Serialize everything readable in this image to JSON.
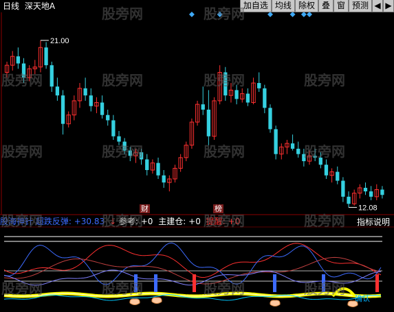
{
  "toolbar": {
    "period": "日线",
    "stock_name": "深天地A",
    "buttons": [
      "加自选",
      "均线",
      "除权",
      "叠",
      "窗",
      "预测"
    ],
    "nav_left": "◀",
    "nav_right": "▶"
  },
  "price_chart": {
    "high_label": "21.00",
    "low_label": "12.08",
    "ylim": [
      11.5,
      22.5
    ],
    "colors": {
      "up": "#ff3030",
      "down": "#35d0e0",
      "diamond": "#3fa9f5",
      "background": "#000000",
      "grid": "#8b0000"
    }
  },
  "markers": {
    "cai": "财",
    "bang": "榜"
  },
  "indicator_bar": {
    "name": "股海神针",
    "rebound_label": "超跌反弹:",
    "rebound_value": "+30.83",
    "reference_label": "参考:",
    "reference_value": "+0",
    "build_label": "主建仓:",
    "build_value": "+0",
    "alert_label": "提醒:",
    "alert_value": "+0",
    "explain_button": "指标说明",
    "buy_tag": "确认"
  },
  "watermark": "股旁网",
  "chart_data": {
    "type": "candlestick",
    "count": 68,
    "ylim": [
      11.5,
      22.5
    ],
    "ohlc": [
      [
        19.2,
        19.8,
        18.9,
        19.6
      ],
      [
        19.6,
        20.4,
        19.3,
        20.1
      ],
      [
        20.1,
        20.6,
        19.4,
        19.7
      ],
      [
        19.7,
        20.0,
        18.6,
        18.9
      ],
      [
        18.9,
        19.6,
        18.7,
        19.4
      ],
      [
        19.4,
        19.9,
        19.1,
        19.5
      ],
      [
        19.5,
        21.0,
        19.2,
        20.6
      ],
      [
        20.6,
        20.9,
        19.4,
        19.6
      ],
      [
        19.6,
        19.8,
        18.1,
        18.4
      ],
      [
        18.4,
        18.9,
        17.6,
        17.9
      ],
      [
        17.9,
        18.2,
        15.7,
        16.3
      ],
      [
        16.3,
        17.0,
        16.1,
        16.8
      ],
      [
        16.8,
        17.9,
        16.5,
        17.6
      ],
      [
        17.6,
        18.6,
        17.2,
        18.3
      ],
      [
        18.3,
        18.9,
        17.6,
        17.9
      ],
      [
        17.9,
        18.3,
        17.0,
        17.3
      ],
      [
        17.3,
        17.8,
        16.9,
        17.5
      ],
      [
        17.5,
        17.9,
        16.6,
        16.8
      ],
      [
        16.8,
        17.1,
        16.2,
        16.5
      ],
      [
        16.5,
        16.8,
        15.4,
        15.6
      ],
      [
        15.6,
        15.9,
        15.1,
        15.3
      ],
      [
        15.3,
        15.5,
        14.6,
        14.8
      ],
      [
        14.8,
        15.0,
        14.2,
        14.5
      ],
      [
        14.5,
        14.9,
        14.1,
        14.7
      ],
      [
        14.7,
        14.9,
        14.0,
        14.3
      ],
      [
        14.3,
        14.6,
        13.4,
        13.7
      ],
      [
        13.7,
        14.3,
        13.5,
        14.1
      ],
      [
        14.1,
        14.4,
        13.2,
        13.4
      ],
      [
        13.4,
        13.7,
        12.7,
        13.0
      ],
      [
        13.0,
        13.4,
        12.5,
        13.2
      ],
      [
        13.2,
        14.0,
        13.0,
        13.8
      ],
      [
        13.8,
        14.6,
        13.6,
        14.4
      ],
      [
        14.4,
        15.3,
        14.2,
        15.1
      ],
      [
        15.1,
        16.6,
        14.9,
        16.4
      ],
      [
        16.4,
        17.6,
        16.2,
        17.4
      ],
      [
        17.4,
        18.4,
        16.8,
        17.1
      ],
      [
        17.1,
        18.2,
        15.1,
        15.6
      ],
      [
        15.6,
        17.8,
        15.4,
        17.6
      ],
      [
        17.6,
        19.6,
        17.4,
        19.2
      ],
      [
        19.2,
        19.5,
        17.6,
        17.9
      ],
      [
        17.9,
        18.6,
        17.5,
        18.2
      ],
      [
        18.2,
        18.5,
        17.4,
        17.7
      ],
      [
        17.7,
        18.3,
        17.5,
        18.0
      ],
      [
        18.0,
        18.3,
        17.3,
        17.5
      ],
      [
        17.5,
        18.9,
        17.4,
        18.6
      ],
      [
        18.6,
        19.2,
        18.1,
        18.3
      ],
      [
        18.3,
        18.5,
        16.9,
        17.2
      ],
      [
        17.2,
        17.4,
        15.8,
        16.0
      ],
      [
        16.0,
        16.2,
        14.3,
        14.6
      ],
      [
        14.6,
        15.2,
        14.3,
        15.0
      ],
      [
        15.0,
        15.4,
        14.6,
        15.2
      ],
      [
        15.2,
        15.7,
        14.8,
        14.9
      ],
      [
        14.9,
        15.3,
        14.4,
        14.6
      ],
      [
        14.6,
        14.9,
        13.9,
        14.2
      ],
      [
        14.2,
        14.8,
        14.0,
        14.5
      ],
      [
        14.5,
        14.9,
        14.2,
        14.4
      ],
      [
        14.4,
        14.7,
        13.8,
        14.0
      ],
      [
        14.0,
        14.3,
        13.2,
        13.4
      ],
      [
        13.4,
        13.8,
        13.0,
        13.6
      ],
      [
        13.6,
        13.9,
        12.9,
        13.1
      ],
      [
        13.1,
        13.3,
        11.9,
        12.2
      ],
      [
        12.2,
        12.5,
        11.6,
        11.8
      ],
      [
        11.8,
        12.6,
        11.7,
        12.4
      ],
      [
        12.4,
        12.9,
        12.1,
        12.7
      ],
      [
        12.7,
        13.0,
        12.3,
        12.5
      ],
      [
        12.5,
        12.8,
        12.0,
        12.2
      ],
      [
        12.2,
        12.9,
        12.0,
        12.6
      ],
      [
        12.6,
        12.8,
        12.1,
        12.3
      ]
    ],
    "diamonds": [
      33,
      38,
      47,
      51,
      53,
      54
    ]
  }
}
